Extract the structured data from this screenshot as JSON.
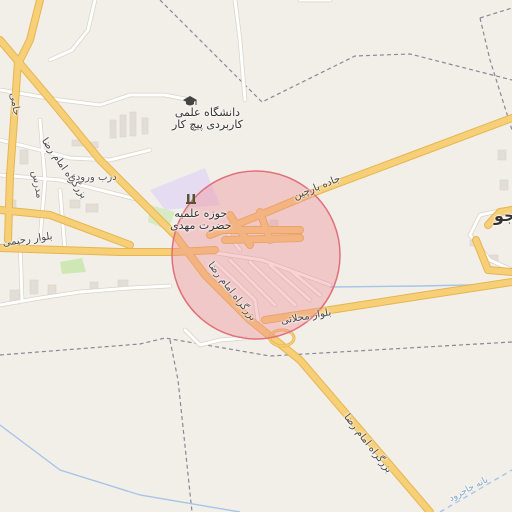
{
  "map": {
    "type": "street-map",
    "colors": {
      "background": "#f2efe9",
      "major_road": "#f6cf77",
      "major_road_casing": "#e6b552",
      "minor_road": "#ffffff",
      "minor_road_casing": "#d9d3c9",
      "boundary": "#8a8796",
      "waterway": "#a7c4e8",
      "seminary_area": "#e6dcf2",
      "park": "#cde8b5",
      "highlight_fill": "#f08a94",
      "highlight_stroke": "#e0707a"
    },
    "highlight": {
      "shape": "circle"
    },
    "pois": [
      {
        "name": "دانشگاه علمی\nکاربردی پیچ کار",
        "icon": "graduation-cap-icon"
      },
      {
        "name": "حوزه علمیه\nحضرت مهدی",
        "icon": "seminary-icon"
      }
    ],
    "labels": {
      "imam_reza_top": "بزرگراه امام رضا",
      "imam_reza_mid": "بزرگراه امام رضا",
      "imam_reza_bottom": "بزرگراه امام رضا",
      "jadeh_barchin": "جاده بارچین",
      "blvd_rahimi": "بلوار رحیمی",
      "blvd_mahalati": "بلوار محلاتی",
      "darb_vorudi": "درب ورودی",
      "jami": "جامی",
      "modares": "مدرس",
      "partial_right": "جو",
      "partial_bottom": "بانه جاجرود"
    }
  }
}
